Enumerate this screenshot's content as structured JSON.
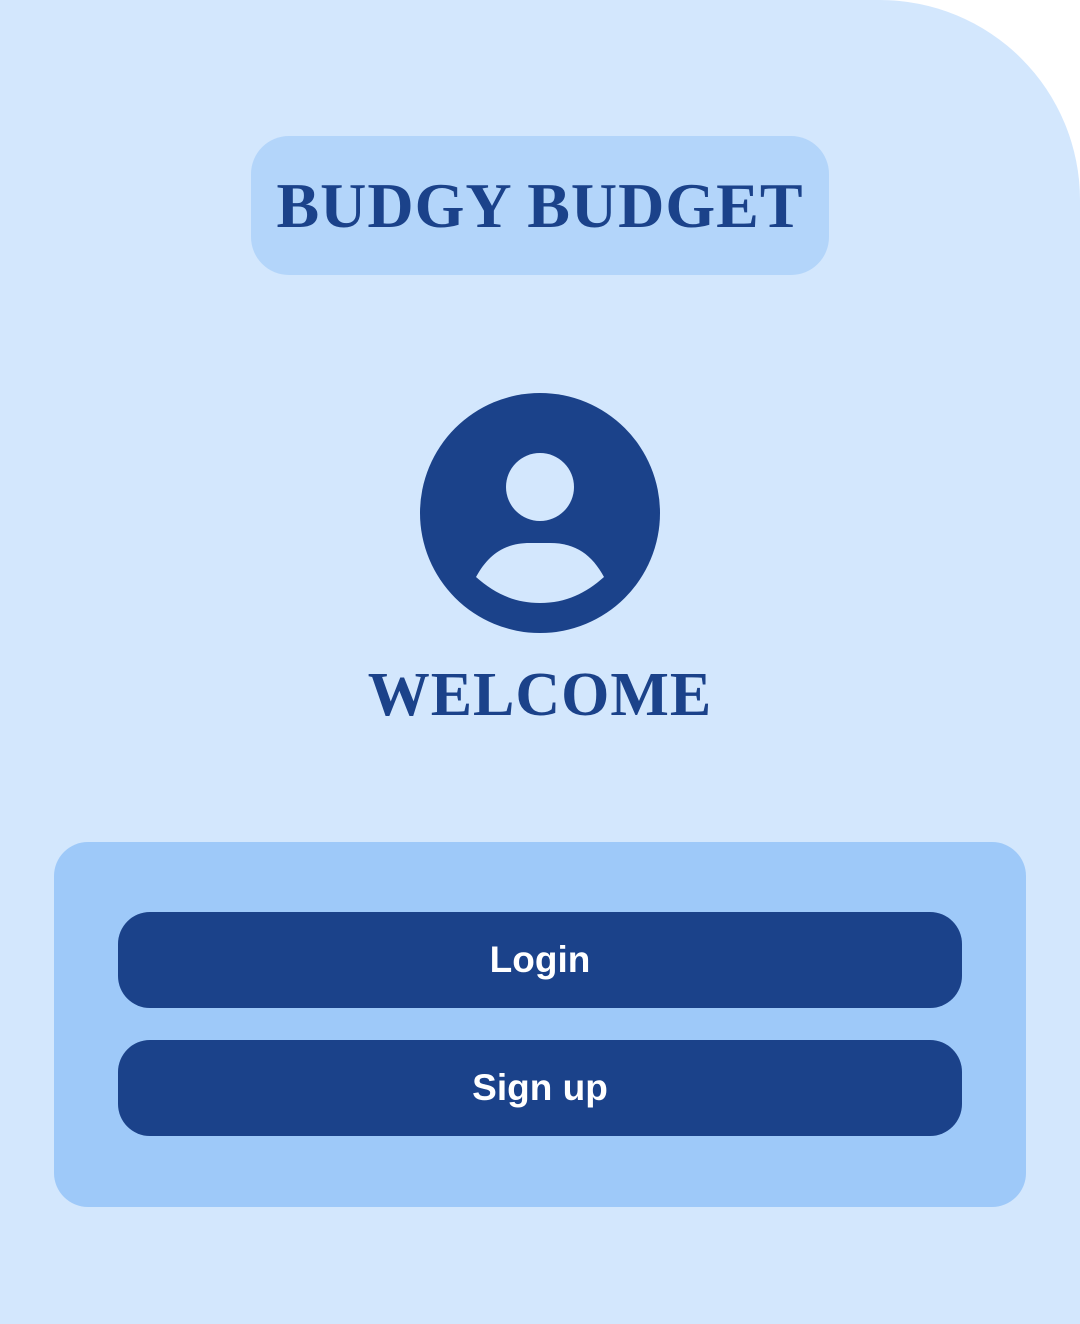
{
  "app": {
    "title": "BUDGY BUDGET"
  },
  "avatar": {
    "icon": "user-circle-icon"
  },
  "welcome": {
    "text": "WELCOME"
  },
  "auth": {
    "login_label": "Login",
    "signup_label": "Sign up"
  },
  "colors": {
    "background": "#d3e7fd",
    "title_pill": "#b3d5fa",
    "card": "#9ec9f9",
    "primary": "#1b428a",
    "button_text": "#ffffff"
  }
}
